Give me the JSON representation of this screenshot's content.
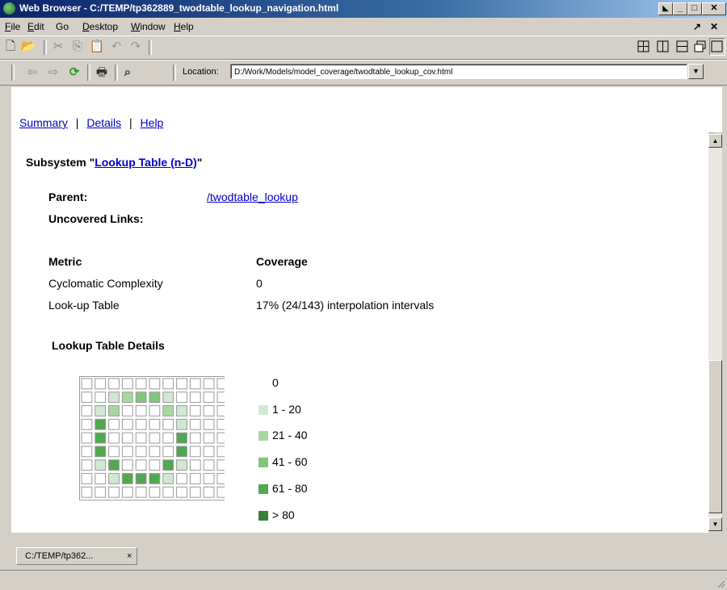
{
  "window": {
    "title": "Web Browser - C:/TEMP/tp362889_twodtable_lookup_navigation.html"
  },
  "menu": [
    "File",
    "Edit",
    "Go",
    "Desktop",
    "Window",
    "Help"
  ],
  "menu_underline": [
    "F",
    "E",
    "",
    "D",
    "W",
    "H"
  ],
  "location": {
    "label": "Location:",
    "value": "D:/Work/Models/model_coverage/twodtable_lookup_cov.html"
  },
  "nav": {
    "summary": "Summary",
    "details": "Details",
    "help": "Help",
    "sep": "|"
  },
  "report": {
    "subsystem_prefix": "Subsystem \"",
    "subsystem_link": "Lookup Table (n-D)",
    "subsystem_suffix": "\"",
    "parent_label": "Parent:",
    "parent_link": "/twodtable_lookup",
    "uncovered_label": "Uncovered Links:",
    "metric_header": "Metric",
    "coverage_header": "Coverage",
    "rows": [
      {
        "metric": "Cyclomatic Complexity",
        "coverage": "0"
      },
      {
        "metric": "Look-up Table",
        "coverage": "17% (24/143) interpolation intervals"
      }
    ],
    "lookup_details_title": "Lookup Table Details",
    "legend": [
      {
        "label": "0",
        "color": "#ffffff"
      },
      {
        "label": "1 - 20",
        "color": "#d3e8d3"
      },
      {
        "label": "21 - 40",
        "color": "#a8d8a0"
      },
      {
        "label": "41 - 60",
        "color": "#7fc77a"
      },
      {
        "label": "61 - 80",
        "color": "#50a850"
      },
      {
        "label": "> 80",
        "color": "#3a7f3a"
      }
    ],
    "grid": [
      [
        0,
        0,
        0,
        0,
        0,
        0,
        0,
        0,
        0,
        0,
        0
      ],
      [
        0,
        0,
        1,
        2,
        3,
        3,
        1,
        0,
        0,
        0,
        0
      ],
      [
        0,
        1,
        2,
        0,
        0,
        0,
        2,
        1,
        0,
        0,
        0
      ],
      [
        0,
        4,
        0,
        0,
        0,
        0,
        0,
        1,
        0,
        0,
        0
      ],
      [
        0,
        4,
        0,
        0,
        0,
        0,
        0,
        4,
        0,
        0,
        0
      ],
      [
        0,
        4,
        0,
        0,
        0,
        0,
        0,
        4,
        0,
        0,
        0
      ],
      [
        0,
        1,
        4,
        0,
        0,
        0,
        4,
        1,
        0,
        0,
        0
      ],
      [
        0,
        0,
        1,
        4,
        4,
        4,
        1,
        0,
        0,
        0,
        0
      ],
      [
        0,
        0,
        0,
        0,
        0,
        0,
        0,
        0,
        0,
        0,
        0
      ]
    ]
  },
  "tab": {
    "label": "C:/TEMP/tp362...",
    "close": "×"
  }
}
